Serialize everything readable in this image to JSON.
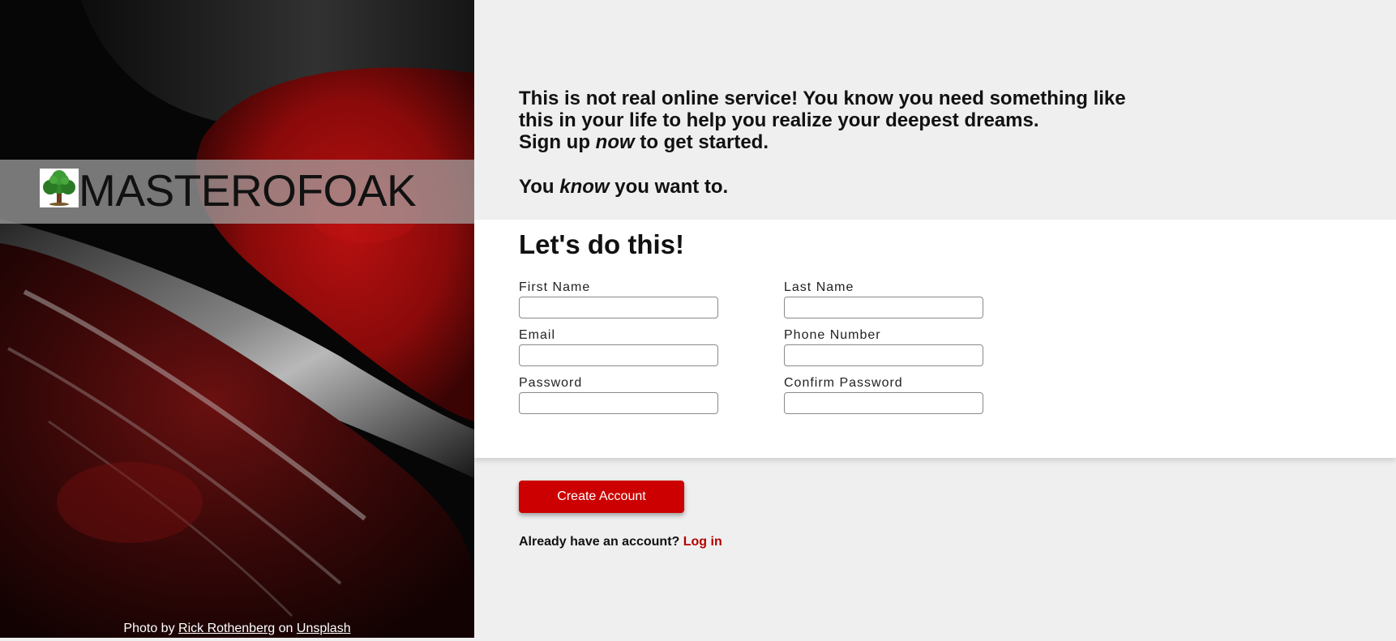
{
  "hero": {
    "brand": "MASTEROFOAK",
    "credit": {
      "prefix": "Photo by",
      "author": "Rick Rothenberg",
      "middle": "on",
      "source": "Unsplash"
    }
  },
  "intro": {
    "line1": "This is not real online service! You know you need something like",
    "line2": "this in your life to help you realize your deepest dreams.",
    "line3_pre": "Sign up ",
    "line3_em": "now",
    "line3_post": " to get started.",
    "line4_pre": "You ",
    "line4_em": "know",
    "line4_post": " you want to."
  },
  "form": {
    "title": "Let's do this!",
    "fields": {
      "first_name": {
        "label": "First Name",
        "value": ""
      },
      "last_name": {
        "label": "Last Name",
        "value": ""
      },
      "email": {
        "label": "Email",
        "value": ""
      },
      "phone": {
        "label": "Phone Number",
        "value": ""
      },
      "password": {
        "label": "Password",
        "value": ""
      },
      "confirm_password": {
        "label": "Confirm Password",
        "value": ""
      }
    }
  },
  "actions": {
    "create_label": "Create Account",
    "login_prompt": "Already have an account?",
    "login_link": "Log in"
  },
  "colors": {
    "accent": "#cc0000",
    "link": "#b30000",
    "page_bg": "#efefef",
    "card_bg": "#ffffff"
  },
  "icons": {
    "logo": "oak-tree-icon"
  }
}
